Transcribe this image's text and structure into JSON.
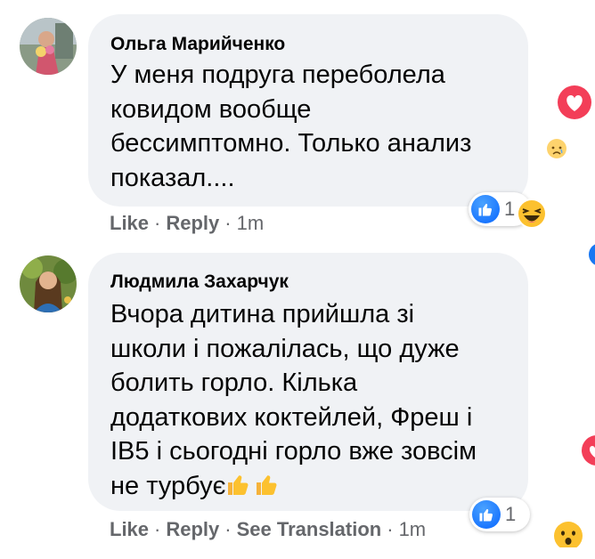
{
  "comments": [
    {
      "author": "Ольга Марийченко",
      "text_lines": [
        "У меня подруга переболела",
        "ковидом вообще",
        "бессимптомно. Только анализ",
        "показал...."
      ],
      "actions": {
        "like": "Like",
        "reply": "Reply",
        "time": "1m"
      },
      "reaction_count": "1",
      "reaction_icons": [
        "like-icon",
        "haha-icon"
      ]
    },
    {
      "author": "Людмила Захарчук",
      "text_lines": [
        "Вчора дитина прийшла зі",
        "школи і пожалілась, що дуже",
        "болить горло. Кілька",
        "додаткових коктейлей, Фреш і",
        "IB5 і сьогодні горло вже зовсім",
        "не турбує"
      ],
      "text_trailing_emojis": [
        "thumbs-up-emoji",
        "thumbs-up-emoji"
      ],
      "actions": {
        "like": "Like",
        "reply": "Reply",
        "see_translation": "See Translation",
        "time": "1m"
      },
      "reaction_count": "1",
      "reaction_icons": [
        "like-icon"
      ]
    }
  ],
  "colors": {
    "bubble": "#f0f2f5",
    "meta_text": "#65676b",
    "like_blue": "#0866ff",
    "love_red": "#f33e58",
    "emoji_yellow": "#fcc12f"
  }
}
